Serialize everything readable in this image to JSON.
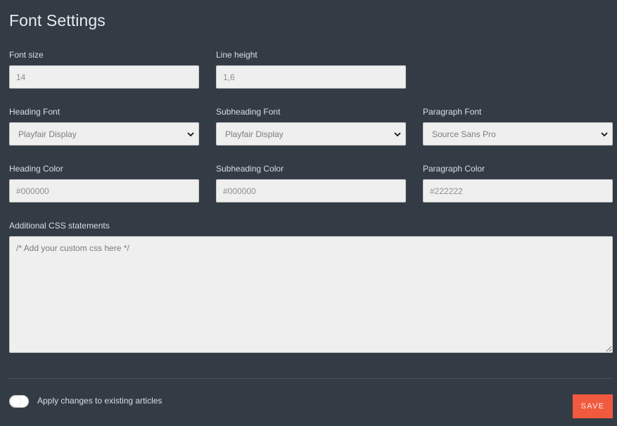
{
  "page": {
    "title": "Font Settings"
  },
  "font_size": {
    "label": "Font size",
    "placeholder": "14"
  },
  "line_height": {
    "label": "Line height",
    "placeholder": "1,6"
  },
  "heading_font": {
    "label": "Heading Font",
    "value": "Playfair Display"
  },
  "subheading_font": {
    "label": "Subheading Font",
    "value": "Playfair Display"
  },
  "paragraph_font": {
    "label": "Paragraph Font",
    "value": "Source Sans Pro"
  },
  "heading_color": {
    "label": "Heading Color",
    "placeholder": "#000000"
  },
  "subheading_color": {
    "label": "Subheading Color",
    "placeholder": "#000000"
  },
  "paragraph_color": {
    "label": "Paragraph Color",
    "placeholder": "#222222"
  },
  "additional_css": {
    "label": "Additional CSS statements",
    "placeholder": "/* Add your custom css here */"
  },
  "apply_changes": {
    "label": "Apply changes to existing articles"
  },
  "save": {
    "label": "SAVE"
  },
  "colors": {
    "background": "#333c45",
    "accent": "#f15a3f",
    "field_bg": "#efefef"
  },
  "icons": {
    "select_arrow": "chevron-down-icon"
  }
}
